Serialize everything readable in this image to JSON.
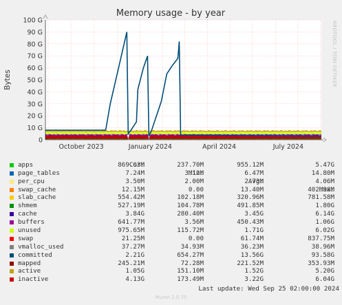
{
  "chart_data": {
    "type": "area",
    "title": "Memory usage - by year",
    "ylabel": "Bytes",
    "ylim": [
      0,
      100
    ],
    "y_unit": "G",
    "y_ticks": [
      "0",
      "10 G",
      "20 G",
      "30 G",
      "40 G",
      "50 G",
      "60 G",
      "70 G",
      "80 G",
      "90 G",
      "100 G"
    ],
    "x_ticks": [
      "October 2023",
      "January 2024",
      "April 2024",
      "July 2024"
    ],
    "side_text": "RRDTOOL / TOBI OETIKER",
    "legend_header": [
      "Cur:",
      "Min:",
      "Avg:",
      "Max:"
    ],
    "series": [
      {
        "name": "apps",
        "color": "#00cc00",
        "cur": "869.63M",
        "min": "237.70M",
        "avg": "955.12M",
        "max": "5.47G"
      },
      {
        "name": "page_tables",
        "color": "#0066b3",
        "cur": "7.24M",
        "min": "3.12M",
        "avg": "6.47M",
        "max": "14.80M"
      },
      {
        "name": "per_cpu",
        "color": "#ffe97f",
        "cur": "3.50M",
        "min": "2.00M",
        "avg": "2.73M",
        "max": "4.06M"
      },
      {
        "name": "swap_cache",
        "color": "#ff8000",
        "cur": "12.15M",
        "min": "0.00",
        "avg": "13.40M",
        "max": "402.98M"
      },
      {
        "name": "slab_cache",
        "color": "#ffcc00",
        "cur": "554.42M",
        "min": "102.18M",
        "avg": "320.96M",
        "max": "781.58M"
      },
      {
        "name": "shmem",
        "color": "#008f00",
        "cur": "527.19M",
        "min": "104.78M",
        "avg": "491.85M",
        "max": "1.80G"
      },
      {
        "name": "cache",
        "color": "#330099",
        "cur": "3.84G",
        "min": "280.40M",
        "avg": "3.45G",
        "max": "6.14G"
      },
      {
        "name": "buffers",
        "color": "#990099",
        "cur": "641.77M",
        "min": "3.56M",
        "avg": "450.43M",
        "max": "1.06G"
      },
      {
        "name": "unused",
        "color": "#ccff00",
        "cur": "975.65M",
        "min": "115.72M",
        "avg": "1.71G",
        "max": "6.02G"
      },
      {
        "name": "swap",
        "color": "#ff0000",
        "cur": "21.25M",
        "min": "0.00",
        "avg": "61.74M",
        "max": "837.75M"
      },
      {
        "name": "vmalloc_used",
        "color": "#808080",
        "cur": "37.27M",
        "min": "34.93M",
        "avg": "36.23M",
        "max": "38.96M"
      },
      {
        "name": "committed",
        "color": "#004d78",
        "cur": "2.21G",
        "min": "654.27M",
        "avg": "13.56G",
        "max": "93.58G"
      },
      {
        "name": "mapped",
        "color": "#8f0000",
        "cur": "245.21M",
        "min": "72.28M",
        "avg": "221.52M",
        "max": "353.93M"
      },
      {
        "name": "active",
        "color": "#c4a000",
        "cur": "1.05G",
        "min": "151.10M",
        "avg": "1.52G",
        "max": "5.20G"
      },
      {
        "name": "inactive",
        "color": "#cc0000",
        "cur": "4.13G",
        "min": "173.49M",
        "avg": "3.22G",
        "max": "6.04G"
      }
    ],
    "committed_line": [
      {
        "t": 0.22,
        "v": 10
      },
      {
        "t": 0.235,
        "v": 30
      },
      {
        "t": 0.26,
        "v": 55
      },
      {
        "t": 0.285,
        "v": 80
      },
      {
        "t": 0.295,
        "v": 90
      },
      {
        "t": 0.3,
        "v": 5
      },
      {
        "t": 0.31,
        "v": 8
      },
      {
        "t": 0.33,
        "v": 15
      },
      {
        "t": 0.335,
        "v": 42
      },
      {
        "t": 0.355,
        "v": 60
      },
      {
        "t": 0.37,
        "v": 70
      },
      {
        "t": 0.375,
        "v": 3
      },
      {
        "t": 0.385,
        "v": 8
      },
      {
        "t": 0.42,
        "v": 32
      },
      {
        "t": 0.44,
        "v": 55
      },
      {
        "t": 0.46,
        "v": 62
      },
      {
        "t": 0.48,
        "v": 68
      },
      {
        "t": 0.485,
        "v": 82
      },
      {
        "t": 0.49,
        "v": 4
      }
    ],
    "grid": true
  },
  "last_update": "Last update: Wed Sep 25 02:00:00 2024",
  "footer": "Munin 2.0.75"
}
